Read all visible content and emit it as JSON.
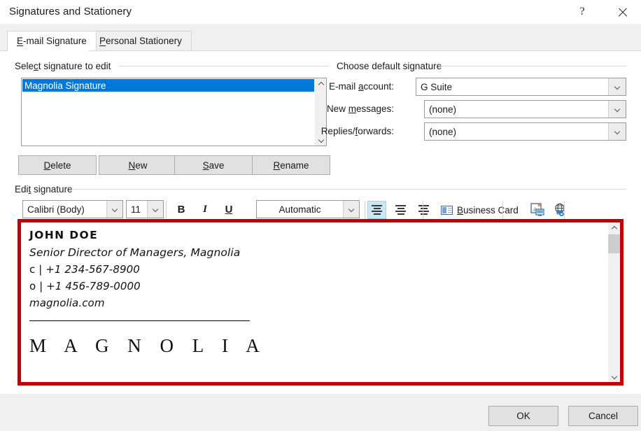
{
  "window": {
    "title": "Signatures and Stationery",
    "help_icon": "question-mark-icon",
    "close_icon": "close-icon"
  },
  "tabs": [
    {
      "label": "E-mail Signature",
      "accel": "E",
      "active": true
    },
    {
      "label": "Personal Stationery",
      "accel": "P",
      "active": false
    }
  ],
  "select_signature": {
    "group_label": "Select signature to edit",
    "items": [
      "Magnolia Signature"
    ],
    "selected_index": 0,
    "buttons": [
      {
        "label": "Delete",
        "accel": "D"
      },
      {
        "label": "New",
        "accel": "N"
      },
      {
        "label": "Save",
        "accel": "S"
      },
      {
        "label": "Rename",
        "accel": "R"
      }
    ]
  },
  "default_signature": {
    "group_label": "Choose default signature",
    "fields": [
      {
        "label": "E-mail account:",
        "value": "G Suite"
      },
      {
        "label": "New messages:",
        "value": "(none)"
      },
      {
        "label": "Replies/forwards:",
        "value": "(none)"
      }
    ]
  },
  "edit_signature": {
    "group_label": "Edit signature",
    "toolbar": {
      "font_family": "Calibri (Body)",
      "font_size": "11",
      "bold": "B",
      "italic": "I",
      "underline": "U",
      "font_color": "Automatic",
      "align_left_icon": "align-left-icon",
      "align_center_icon": "align-center-icon",
      "align_right_icon": "align-right-icon",
      "business_card": "Business Card",
      "picture_icon": "insert-picture-icon",
      "hyperlink_icon": "insert-hyperlink-icon"
    },
    "content": {
      "name": "JOHN DOE",
      "title": "Senior Director of Managers, Magnolia",
      "cell_prefix": "c | ",
      "cell": "+1 234-567-8900",
      "office_prefix": "o | ",
      "office": "+1 456-789-0000",
      "website": "magnolia.com",
      "brand": "M A G N O L I A"
    },
    "highlight_color": "#c00000"
  },
  "footer": {
    "ok": "OK",
    "cancel": "Cancel"
  }
}
